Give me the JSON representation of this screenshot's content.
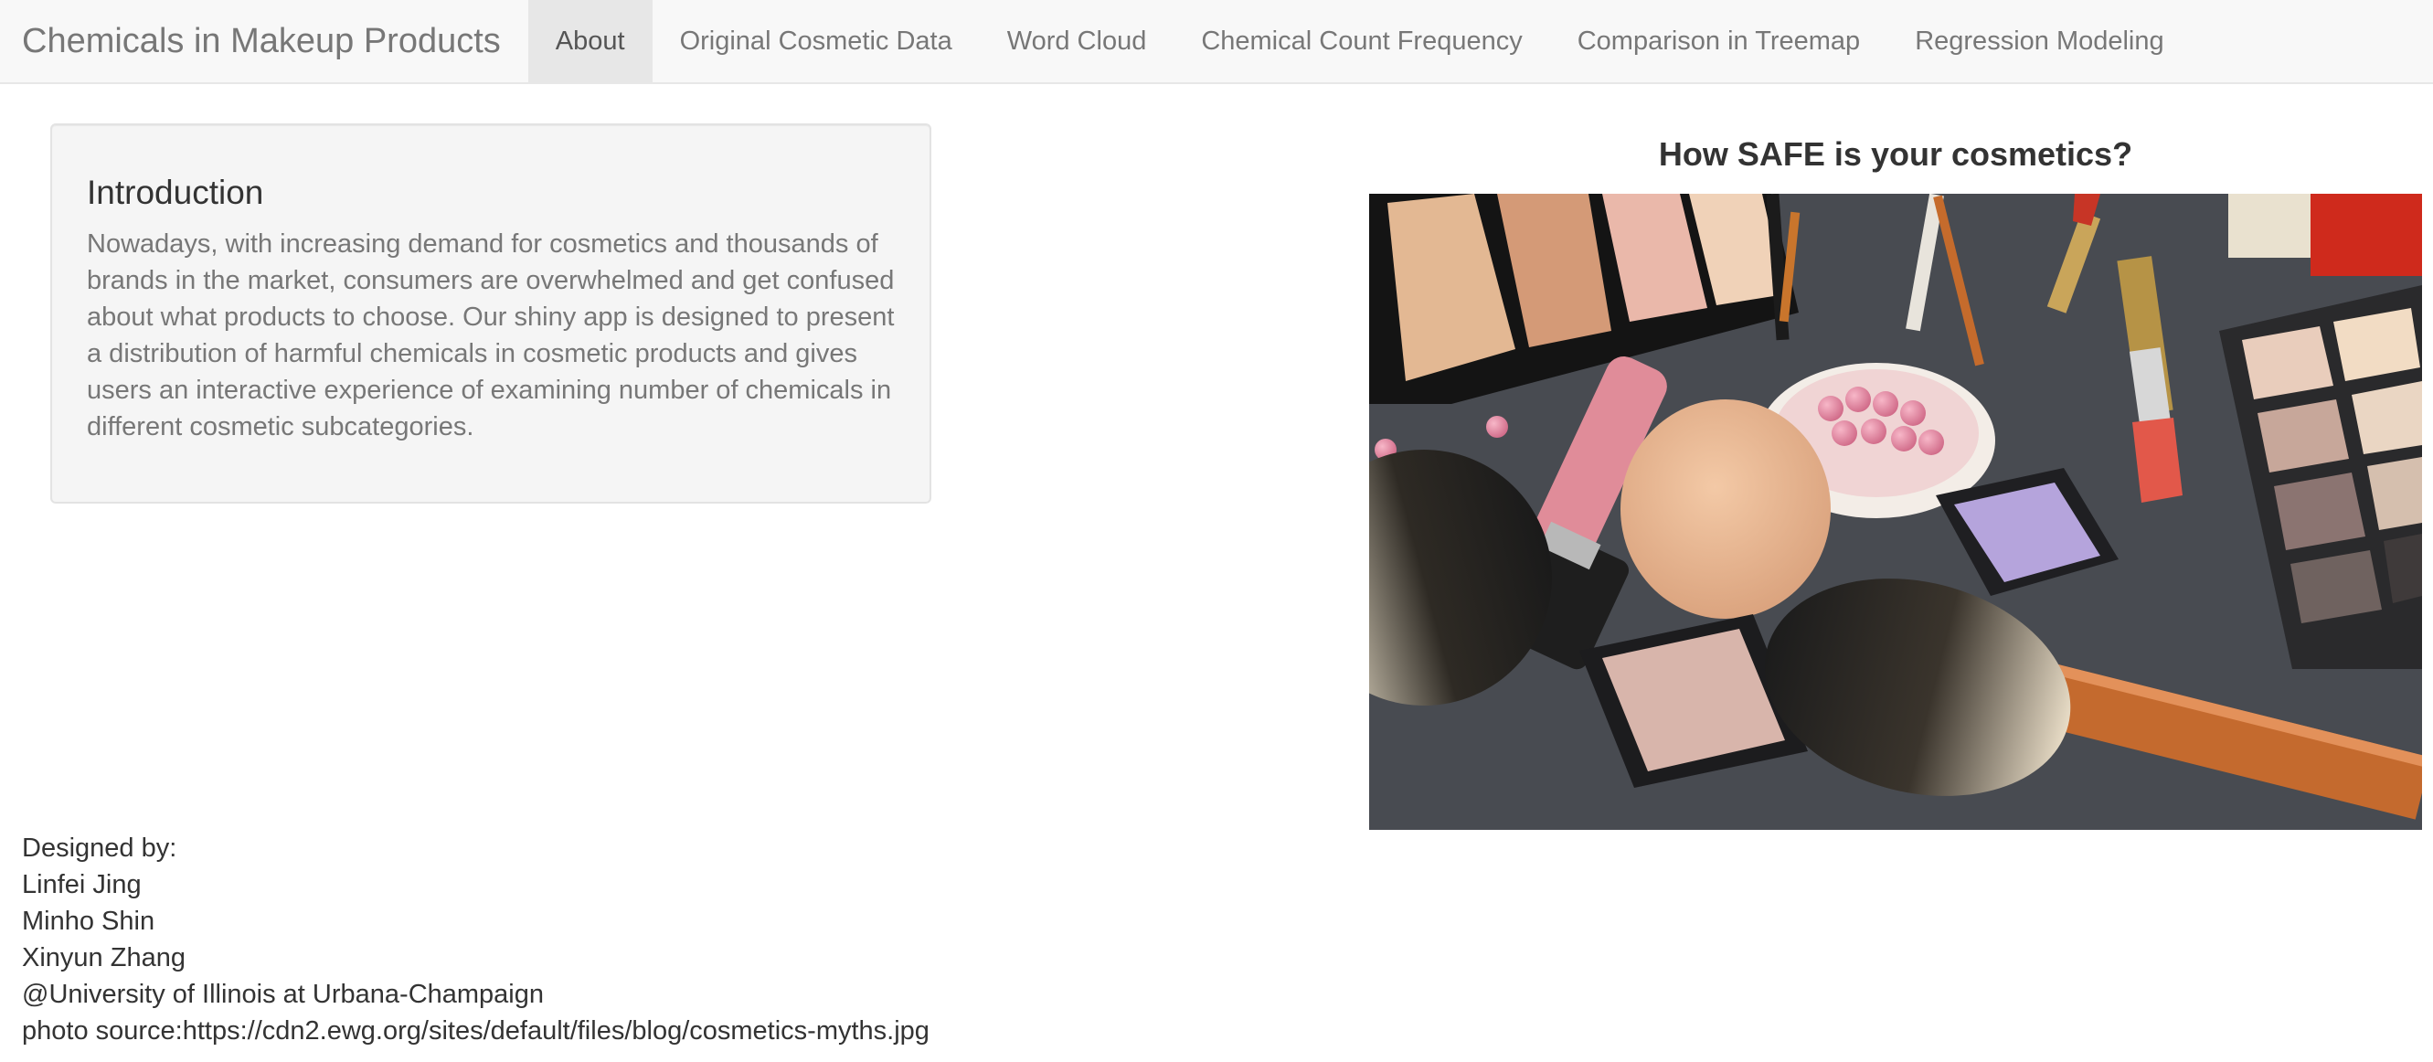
{
  "navbar": {
    "brand": "Chemicals in Makeup Products",
    "tabs": [
      {
        "label": "About",
        "active": true
      },
      {
        "label": "Original Cosmetic Data",
        "active": false
      },
      {
        "label": "Word Cloud",
        "active": false
      },
      {
        "label": "Chemical Count Frequency",
        "active": false
      },
      {
        "label": "Comparison in Treemap",
        "active": false
      },
      {
        "label": "Regression Modeling",
        "active": false
      }
    ]
  },
  "intro": {
    "title": "Introduction",
    "text": "Nowadays, with increasing demand for cosmetics and thousands of brands in the market, consumers are overwhelmed and get confused about what products to choose. Our shiny app is designed to present a distribution of harmful chemicals in cosmetic products and gives users an interactive experience of examining number of chemicals in different cosmetic subcategories."
  },
  "image_panel": {
    "title": "How SAFE is your cosmetics?"
  },
  "credits": {
    "designed_by": "Designed by:",
    "authors": [
      "Linfei Jing",
      "Minho Shin",
      "Xinyun Zhang"
    ],
    "affiliation": "@University of Illinois at Urbana-Champaign",
    "photo_source": "photo source:https://cdn2.ewg.org/sites/default/files/blog/cosmetics-myths.jpg"
  },
  "colors": {
    "navbar_bg": "#f8f8f8",
    "active_tab_bg": "#e7e7e7",
    "nav_text": "#777777",
    "panel_bg": "#f5f5f5",
    "body_text": "#333333"
  }
}
